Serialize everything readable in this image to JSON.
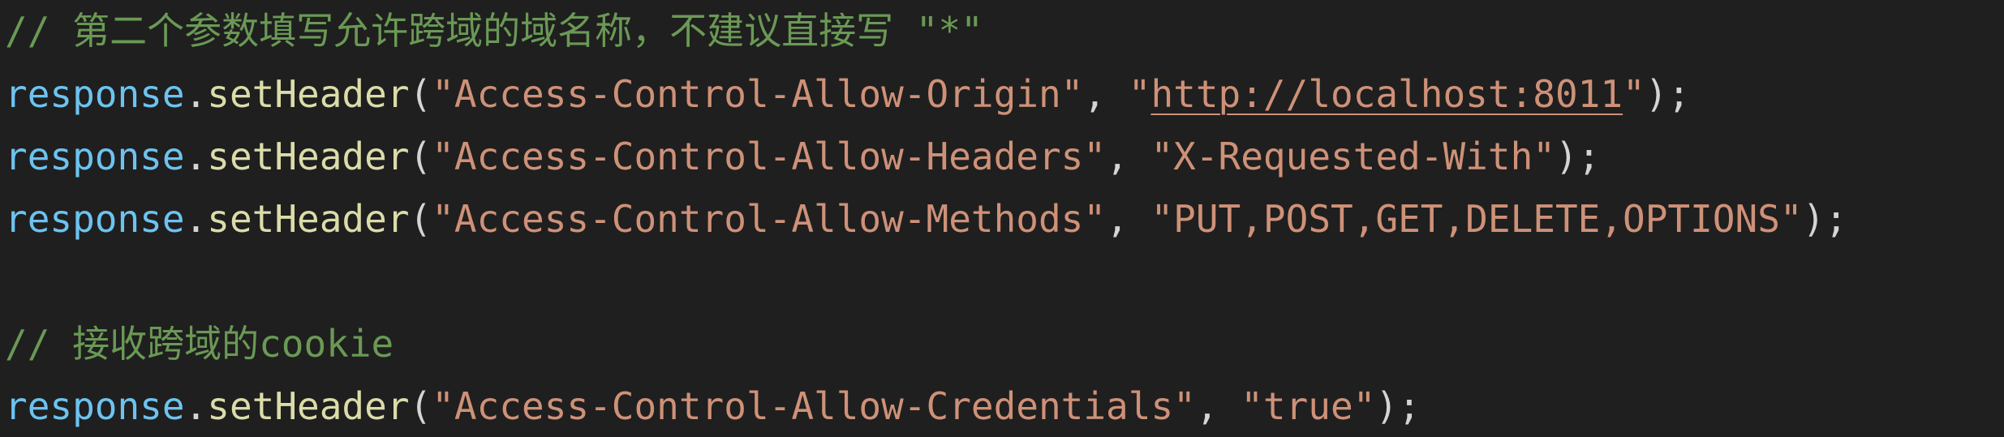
{
  "editor": {
    "colors": {
      "background": "#1f1f1f",
      "comment": "#6a9955",
      "identifier": "#6cc3f0",
      "method": "#dcdcaa",
      "string": "#ce9178",
      "punctuation": "#d4d4d4"
    },
    "lines": [
      {
        "comment": "// 第二个参数填写允许跨域的域名称，不建议直接写 \"*\""
      },
      {
        "object": "response",
        "dot": ".",
        "method": "setHeader",
        "open": "(",
        "arg1": "\"Access-Control-Allow-Origin\"",
        "sep": ", ",
        "arg2_quote_open": "\"",
        "arg2_url": "http://localhost:8011",
        "arg2_quote_close": "\"",
        "close": ");"
      },
      {
        "object": "response",
        "dot": ".",
        "method": "setHeader",
        "open": "(",
        "arg1": "\"Access-Control-Allow-Headers\"",
        "sep": ", ",
        "arg2": "\"X-Requested-With\"",
        "close": ");"
      },
      {
        "object": "response",
        "dot": ".",
        "method": "setHeader",
        "open": "(",
        "arg1": "\"Access-Control-Allow-Methods\"",
        "sep": ", ",
        "arg2": "\"PUT,POST,GET,DELETE,OPTIONS\"",
        "close": ");"
      },
      {
        "comment": "// 接收跨域的cookie"
      },
      {
        "object": "response",
        "dot": ".",
        "method": "setHeader",
        "open": "(",
        "arg1": "\"Access-Control-Allow-Credentials\"",
        "sep": ", ",
        "arg2": "\"true\"",
        "close": ");"
      }
    ]
  }
}
